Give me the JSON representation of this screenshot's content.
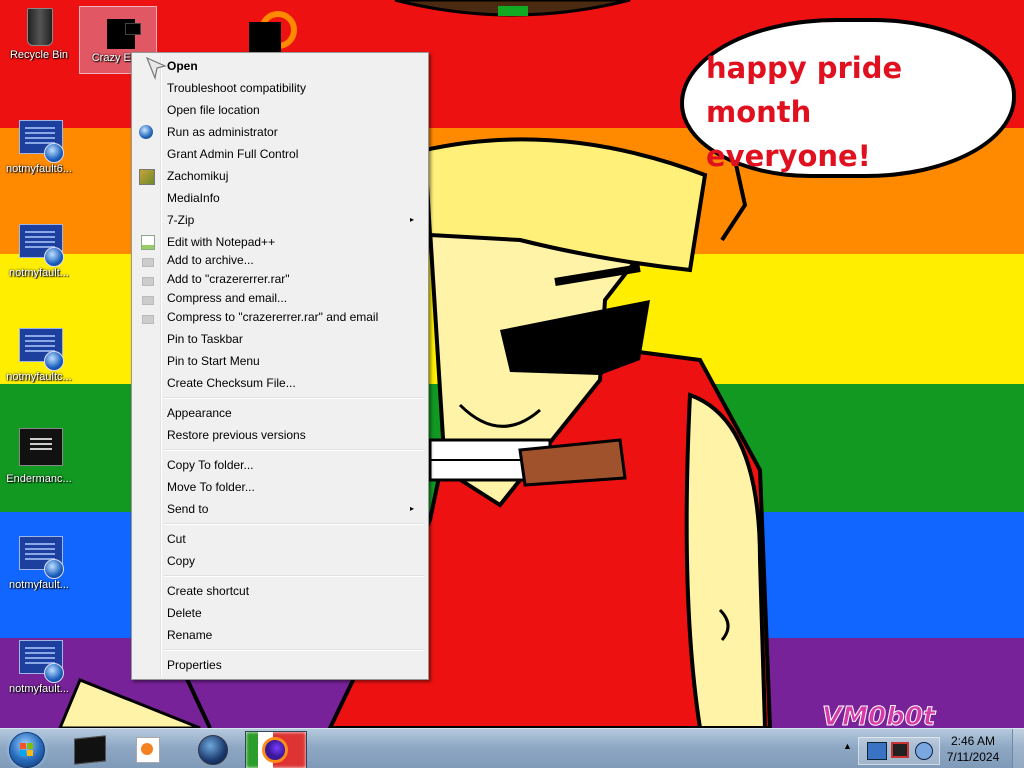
{
  "desktop": {
    "icons": [
      {
        "label": "Recycle Bin",
        "icon": "recycle-bin-icon"
      },
      {
        "label": "Crazy Erro",
        "icon": "app-icon"
      },
      {
        "label": "notmyfault6...",
        "icon": "bsod-app-icon"
      },
      {
        "label": "notmyfault...",
        "icon": "bsod-app-icon"
      },
      {
        "label": "notmyfaultc...",
        "icon": "bsod-app-icon"
      },
      {
        "label": "Endermanc...",
        "icon": "console-app-icon"
      },
      {
        "label": "notmyfault...",
        "icon": "bsod-app-icon"
      },
      {
        "label": "notmyfault...",
        "icon": "bsod-app-icon"
      }
    ],
    "speech_bubble": {
      "line1": "happy pride month",
      "line2": "everyone!"
    },
    "watermark": "VM0b0t",
    "colors": {
      "red": "#ee1111",
      "orange": "#ff8a00",
      "yellow": "#ffee00",
      "green": "#119922",
      "blue": "#1166ff",
      "purple": "#772299",
      "bubble_text": "#e0101e"
    }
  },
  "context_menu": {
    "items": [
      {
        "label": "Open",
        "bold": true
      },
      {
        "label": "Troubleshoot compatibility"
      },
      {
        "label": "Open file location"
      },
      {
        "label": "Run as administrator",
        "icon": "shield-globe-icon"
      },
      {
        "label": "Grant Admin Full Control"
      },
      {
        "label": "Zachomikuj",
        "icon": "hamster-icon"
      },
      {
        "label": "MediaInfo"
      },
      {
        "label": "7-Zip",
        "submenu": true
      },
      {
        "label": "Edit with Notepad++",
        "icon": "notepad-plus-icon"
      },
      {
        "label": "Add to archive...",
        "icon": "archive-icon"
      },
      {
        "label": "Add to \"crazererrer.rar\"",
        "icon": "archive-icon"
      },
      {
        "label": "Compress and email...",
        "icon": "archive-icon"
      },
      {
        "label": "Compress to \"crazererrer.rar\" and email",
        "icon": "archive-icon"
      },
      {
        "label": "Pin to Taskbar"
      },
      {
        "label": "Pin to Start Menu"
      },
      {
        "label": "Create Checksum File..."
      },
      {
        "label": "Appearance"
      },
      {
        "label": "Restore previous versions"
      },
      {
        "label": "Copy To folder..."
      },
      {
        "label": "Move To folder..."
      },
      {
        "label": "Send to",
        "submenu": true
      },
      {
        "label": "Cut"
      },
      {
        "label": "Copy"
      },
      {
        "label": "Create shortcut"
      },
      {
        "label": "Delete"
      },
      {
        "label": "Rename"
      },
      {
        "label": "Properties"
      }
    ],
    "submenu_arrow": "▸"
  },
  "taskbar": {
    "start": "start-orb-icon",
    "pinned": [
      "terminal-icon",
      "media-player-icon",
      "browser-globe-icon",
      "firefox-icon"
    ],
    "tray_expand": "▲",
    "clock": {
      "time": "2:46 AM",
      "date": "7/11/2024"
    }
  }
}
